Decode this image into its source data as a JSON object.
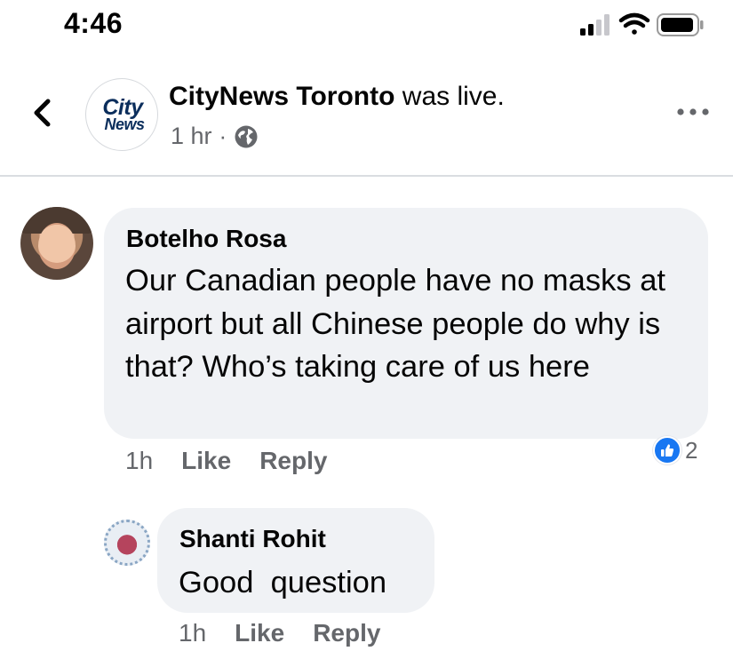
{
  "status_bar": {
    "time": "4:46",
    "icons": [
      "cellular-signal-icon",
      "wifi-icon",
      "battery-icon"
    ]
  },
  "header": {
    "back_icon": "chevron-left-icon",
    "logo": {
      "line1": "City",
      "line2": "News"
    },
    "page_name": "CityNews Toronto",
    "action_text": " was live.",
    "time_ago": "1 hr",
    "separator": "·",
    "audience_icon": "globe-icon",
    "more_icon": "more-horizontal-icon"
  },
  "comments": [
    {
      "author": "Botelho Rosa",
      "text": "Our Canadian people have no masks at airport but all Chinese people do why is that? Who’s taking care of us here",
      "time": "1h",
      "like_label": "Like",
      "reply_label": "Reply",
      "reaction_icon": "like-reaction-icon",
      "reaction_count": "2"
    },
    {
      "author": "Shanti Rohit",
      "text": "Good  question",
      "time": "1h",
      "like_label": "Like",
      "reply_label": "Reply"
    }
  ],
  "colors": {
    "link_blue": "#1877f2",
    "bubble_bg": "#f0f2f5",
    "secondary_text": "#65676b",
    "logo_navy": "#0b2e5c"
  }
}
